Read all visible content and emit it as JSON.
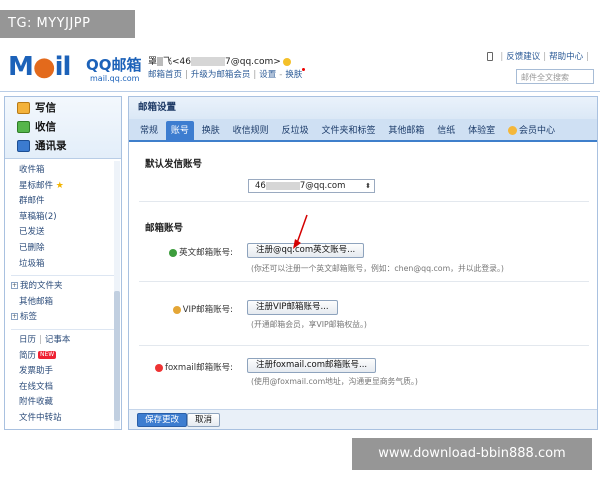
{
  "watermarks": {
    "top_left": "TG: MYYJJPP",
    "bottom_right": "www.download-bbin888.com"
  },
  "header": {
    "logo_text": "M",
    "logo_rest": "il",
    "logo_qq": "QQ邮箱",
    "logo_url": "mail.qq.com",
    "user_name": "罩",
    "user_email_prefix": "飞<46",
    "user_email_suffix": "7@qq.com>",
    "user_links": [
      "邮箱首页",
      "升级为邮箱会员",
      "设置",
      "换肤"
    ],
    "top_links": [
      "反馈建议",
      "帮助中心"
    ],
    "search_placeholder": "邮件全文搜索"
  },
  "sidebar": {
    "actions": [
      "写信",
      "收信",
      "通讯录"
    ],
    "items": [
      "收件箱",
      "星标邮件",
      "群邮件",
      "草稿箱(2)",
      "已发送",
      "已删除",
      "垃圾箱"
    ],
    "folders": [
      "我的文件夹",
      "其他邮箱",
      "标签"
    ],
    "tools": [
      "日历",
      "记事本",
      "简历",
      "发票助手",
      "在线文档",
      "附件收藏",
      "文件中转站"
    ],
    "new_badge": "NEW"
  },
  "main": {
    "title": "邮箱设置",
    "tabs": [
      "常规",
      "账号",
      "换肤",
      "收信规则",
      "反垃圾",
      "文件夹和标签",
      "其他邮箱",
      "信纸",
      "体验室",
      "会员中心"
    ],
    "active_tab": "账号",
    "default_section": "默认发信账号",
    "default_value_prefix": "46",
    "default_value_suffix": "7@qq.com",
    "accounts_section": "邮箱账号",
    "rows": [
      {
        "label": "英文邮箱账号:",
        "button": "注册@qq.com英文账号...",
        "hint": "(你还可以注册一个英文邮箱账号，例如：chen@qq.com，并以此登录。)"
      },
      {
        "label": "VIP邮箱账号:",
        "button": "注册VIP邮箱账号...",
        "hint": "(开通邮箱会员，享VIP邮箱权益。)"
      },
      {
        "label": "foxmail邮箱账号:",
        "button": "注册foxmail.com邮箱账号...",
        "hint": "(使用@foxmail.com地址，沟通更显商务气质。)"
      }
    ],
    "save_label": "保存更改",
    "cancel_label": "取消"
  },
  "colors": {
    "accent": "#3d7dd0",
    "tab_bar": "#cfe0f3",
    "logo_blue": "#1c62b9",
    "logo_orange": "#e36a1c"
  }
}
